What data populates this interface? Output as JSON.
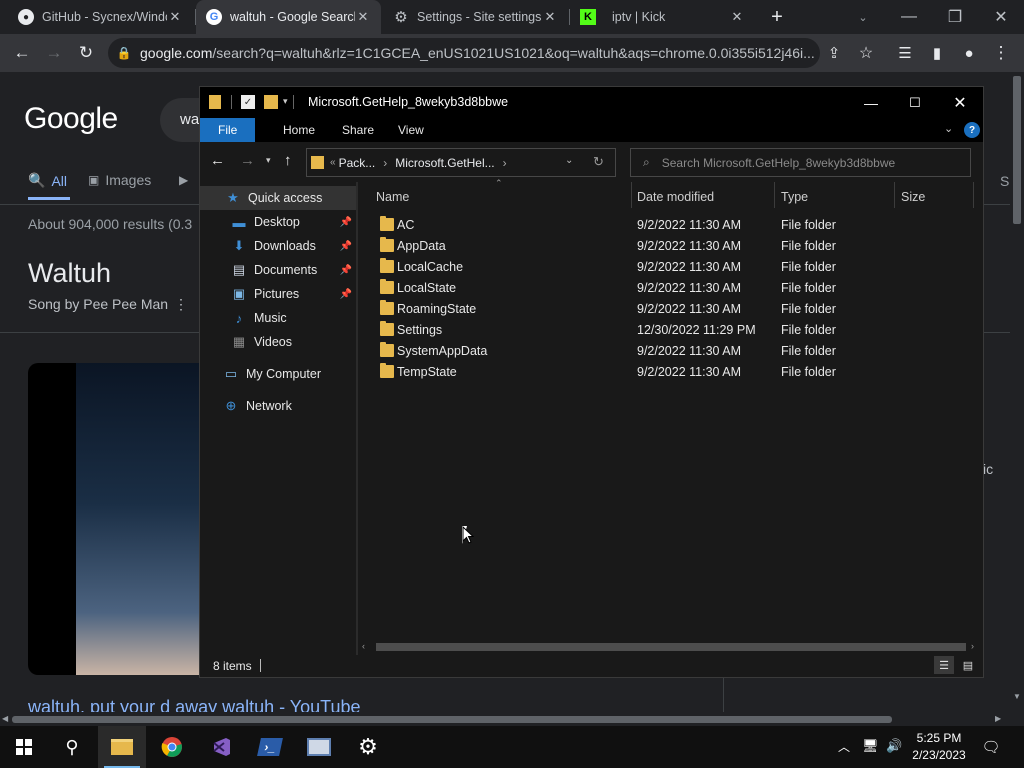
{
  "browser": {
    "tabs": [
      {
        "title": "GitHub - Sycnex/Windo",
        "icon": "github-icon"
      },
      {
        "title": "waltuh - Google Search",
        "icon": "google-icon"
      },
      {
        "title": "Settings - Site settings",
        "icon": "gear-icon"
      },
      {
        "title": "iptv | Kick",
        "icon": "kick-icon"
      }
    ],
    "new_tab": "+",
    "url_host": "google.com",
    "url_rest": "/search?q=waltuh&rlz=1C1GCEA_enUS1021US1021&oq=waltuh&aqs=chrome.0.0i355i512j46i..."
  },
  "google": {
    "logo": "Google",
    "search_partial": "wa",
    "tabs": [
      {
        "label": "All"
      },
      {
        "label": "Images"
      }
    ],
    "results_stats": "About 904,000 results (0.3",
    "kp_title": "Waltuh",
    "kp_sub": "Song by Pee Pee Man",
    "video_title": "waltuh, put your d away waltuh - YouTube",
    "right_frag": "ic",
    "right_s": "S"
  },
  "explorer": {
    "title": "Microsoft.GetHelp_8wekyb3d8bbwe",
    "ribbon": [
      "File",
      "Home",
      "Share",
      "View"
    ],
    "breadcrumb": [
      "Pack...",
      "Microsoft.GetHel..."
    ],
    "search_placeholder": "Search Microsoft.GetHelp_8wekyb3d8bbwe",
    "columns": {
      "name": "Name",
      "date": "Date modified",
      "type": "Type",
      "size": "Size"
    },
    "nav": [
      {
        "label": "Quick access",
        "icon": "star-icon",
        "pinned": false
      },
      {
        "label": "Desktop",
        "icon": "desktop-icon",
        "pinned": true
      },
      {
        "label": "Downloads",
        "icon": "download-icon",
        "pinned": true
      },
      {
        "label": "Documents",
        "icon": "document-icon",
        "pinned": true
      },
      {
        "label": "Pictures",
        "icon": "picture-icon",
        "pinned": true
      },
      {
        "label": "Music",
        "icon": "music-icon",
        "pinned": false
      },
      {
        "label": "Videos",
        "icon": "video-icon",
        "pinned": false
      },
      {
        "label": "My Computer",
        "icon": "computer-icon",
        "pinned": false
      },
      {
        "label": "Network",
        "icon": "network-icon",
        "pinned": false
      }
    ],
    "files": [
      {
        "name": "AC",
        "date": "9/2/2022 11:30 AM",
        "type": "File folder"
      },
      {
        "name": "AppData",
        "date": "9/2/2022 11:30 AM",
        "type": "File folder"
      },
      {
        "name": "LocalCache",
        "date": "9/2/2022 11:30 AM",
        "type": "File folder"
      },
      {
        "name": "LocalState",
        "date": "9/2/2022 11:30 AM",
        "type": "File folder"
      },
      {
        "name": "RoamingState",
        "date": "9/2/2022 11:30 AM",
        "type": "File folder"
      },
      {
        "name": "Settings",
        "date": "12/30/2022 11:29 PM",
        "type": "File folder"
      },
      {
        "name": "SystemAppData",
        "date": "9/2/2022 11:30 AM",
        "type": "File folder"
      },
      {
        "name": "TempState",
        "date": "9/2/2022 11:30 AM",
        "type": "File folder"
      }
    ],
    "status": "8 items"
  },
  "taskbar": {
    "time": "5:25 PM",
    "date": "2/23/2023",
    "apps": [
      "start-icon",
      "search-icon",
      "file-explorer-icon",
      "chrome-icon",
      "visual-studio-icon",
      "powershell-icon",
      "remote-desktop-icon",
      "settings-icon"
    ]
  },
  "colors": {
    "accent": "#1a6fbf",
    "folder": "#e6b84c",
    "link": "#8ab4f8"
  }
}
